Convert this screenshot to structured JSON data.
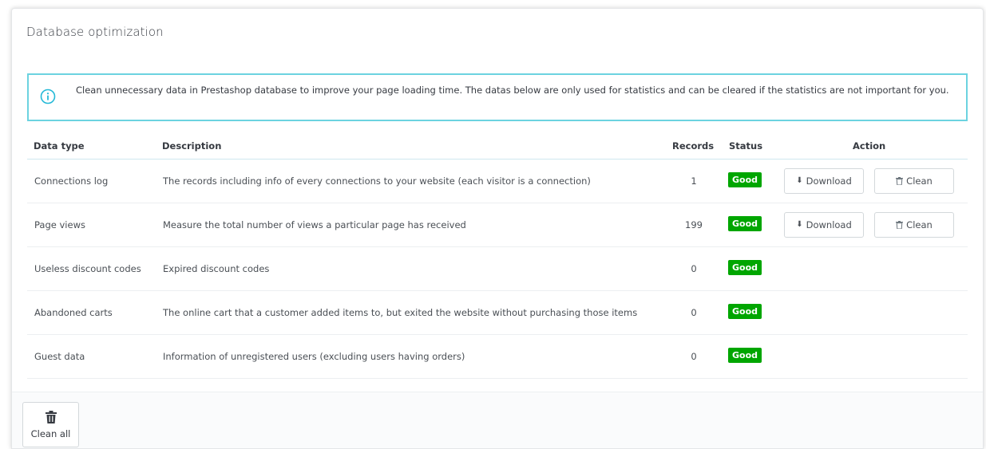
{
  "panel": {
    "title": "Database optimization"
  },
  "alert": {
    "icon": "info-circle-icon",
    "text": "Clean unnecessary data in Prestashop database to improve your page loading time. The datas below are only used for statistics and can be cleared if the statistics are not important for you.",
    "border_color": "#6cd3e0"
  },
  "table": {
    "headers": {
      "data_type": "Data type",
      "description": "Description",
      "records": "Records",
      "status": "Status",
      "action": "Action"
    },
    "rows": [
      {
        "data_type": "Connections log",
        "description": "The records including info of every connections to your website (each visitor is a connection)",
        "records": "1",
        "status": "Good",
        "download": "Download",
        "clean": "Clean"
      },
      {
        "data_type": "Page views",
        "description": "Measure the total number of views a particular page has received",
        "records": "199",
        "status": "Good",
        "download": "Download",
        "clean": "Clean"
      },
      {
        "data_type": "Useless discount codes",
        "description": "Expired discount codes",
        "records": "0",
        "status": "Good"
      },
      {
        "data_type": "Abandoned carts",
        "description": "The online cart that a customer added items to, but exited the website without purchasing those items",
        "records": "0",
        "status": "Good"
      },
      {
        "data_type": "Guest data",
        "description": "Information of unregistered users (excluding users having orders)",
        "records": "0",
        "status": "Good"
      }
    ]
  },
  "footer": {
    "clean_all_label": "Clean all",
    "clean_all_icon": "trash-icon"
  },
  "colors": {
    "status_good": "#00a600",
    "text": "#363a41"
  }
}
